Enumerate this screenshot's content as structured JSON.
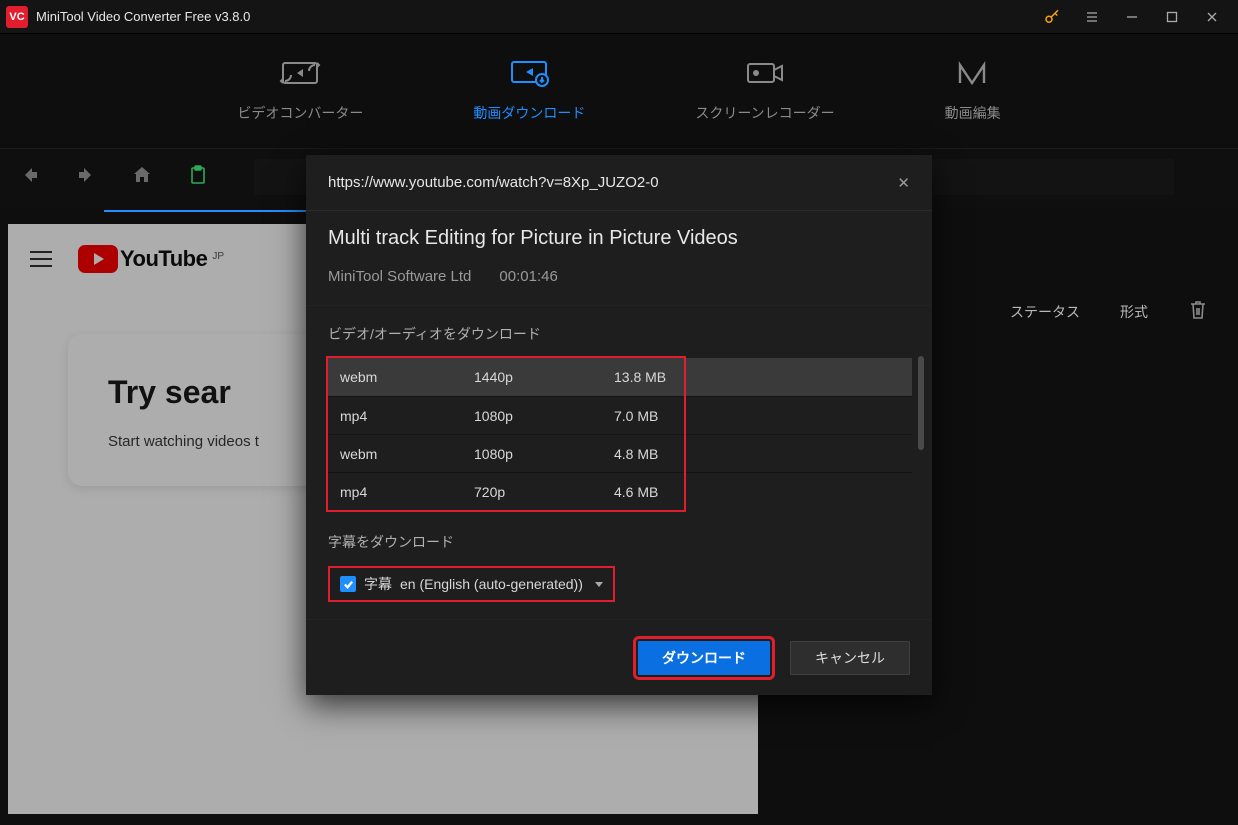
{
  "titlebar": {
    "app_name": "MiniTool Video Converter Free v3.8.0"
  },
  "tabs": [
    {
      "label": "ビデオコンバーター"
    },
    {
      "label": "動画ダウンロード"
    },
    {
      "label": "スクリーンレコーダー"
    },
    {
      "label": "動画編集"
    }
  ],
  "background": {
    "youtube_word": "YouTube",
    "youtube_region": "JP",
    "headline": "Try sear",
    "subline": "Start watching videos t"
  },
  "right_headers": {
    "status": "ステータス",
    "format": "形式"
  },
  "modal": {
    "url": "https://www.youtube.com/watch?v=8Xp_JUZO2-0",
    "title": "Multi track Editing for Picture in Picture Videos",
    "author": "MiniTool Software Ltd",
    "duration": "00:01:46",
    "section_download": "ビデオ/オーディオをダウンロード",
    "formats": [
      {
        "format": "webm",
        "res": "1440p",
        "size": "13.8 MB",
        "selected": true
      },
      {
        "format": "mp4",
        "res": "1080p",
        "size": "7.0 MB",
        "selected": false
      },
      {
        "format": "webm",
        "res": "1080p",
        "size": "4.8 MB",
        "selected": false
      },
      {
        "format": "mp4",
        "res": "720p",
        "size": "4.6 MB",
        "selected": false
      }
    ],
    "section_subtitle": "字幕をダウンロード",
    "subtitle_label": "字幕",
    "subtitle_value": "en (English (auto-generated))",
    "btn_download": "ダウンロード",
    "btn_cancel": "キャンセル"
  }
}
